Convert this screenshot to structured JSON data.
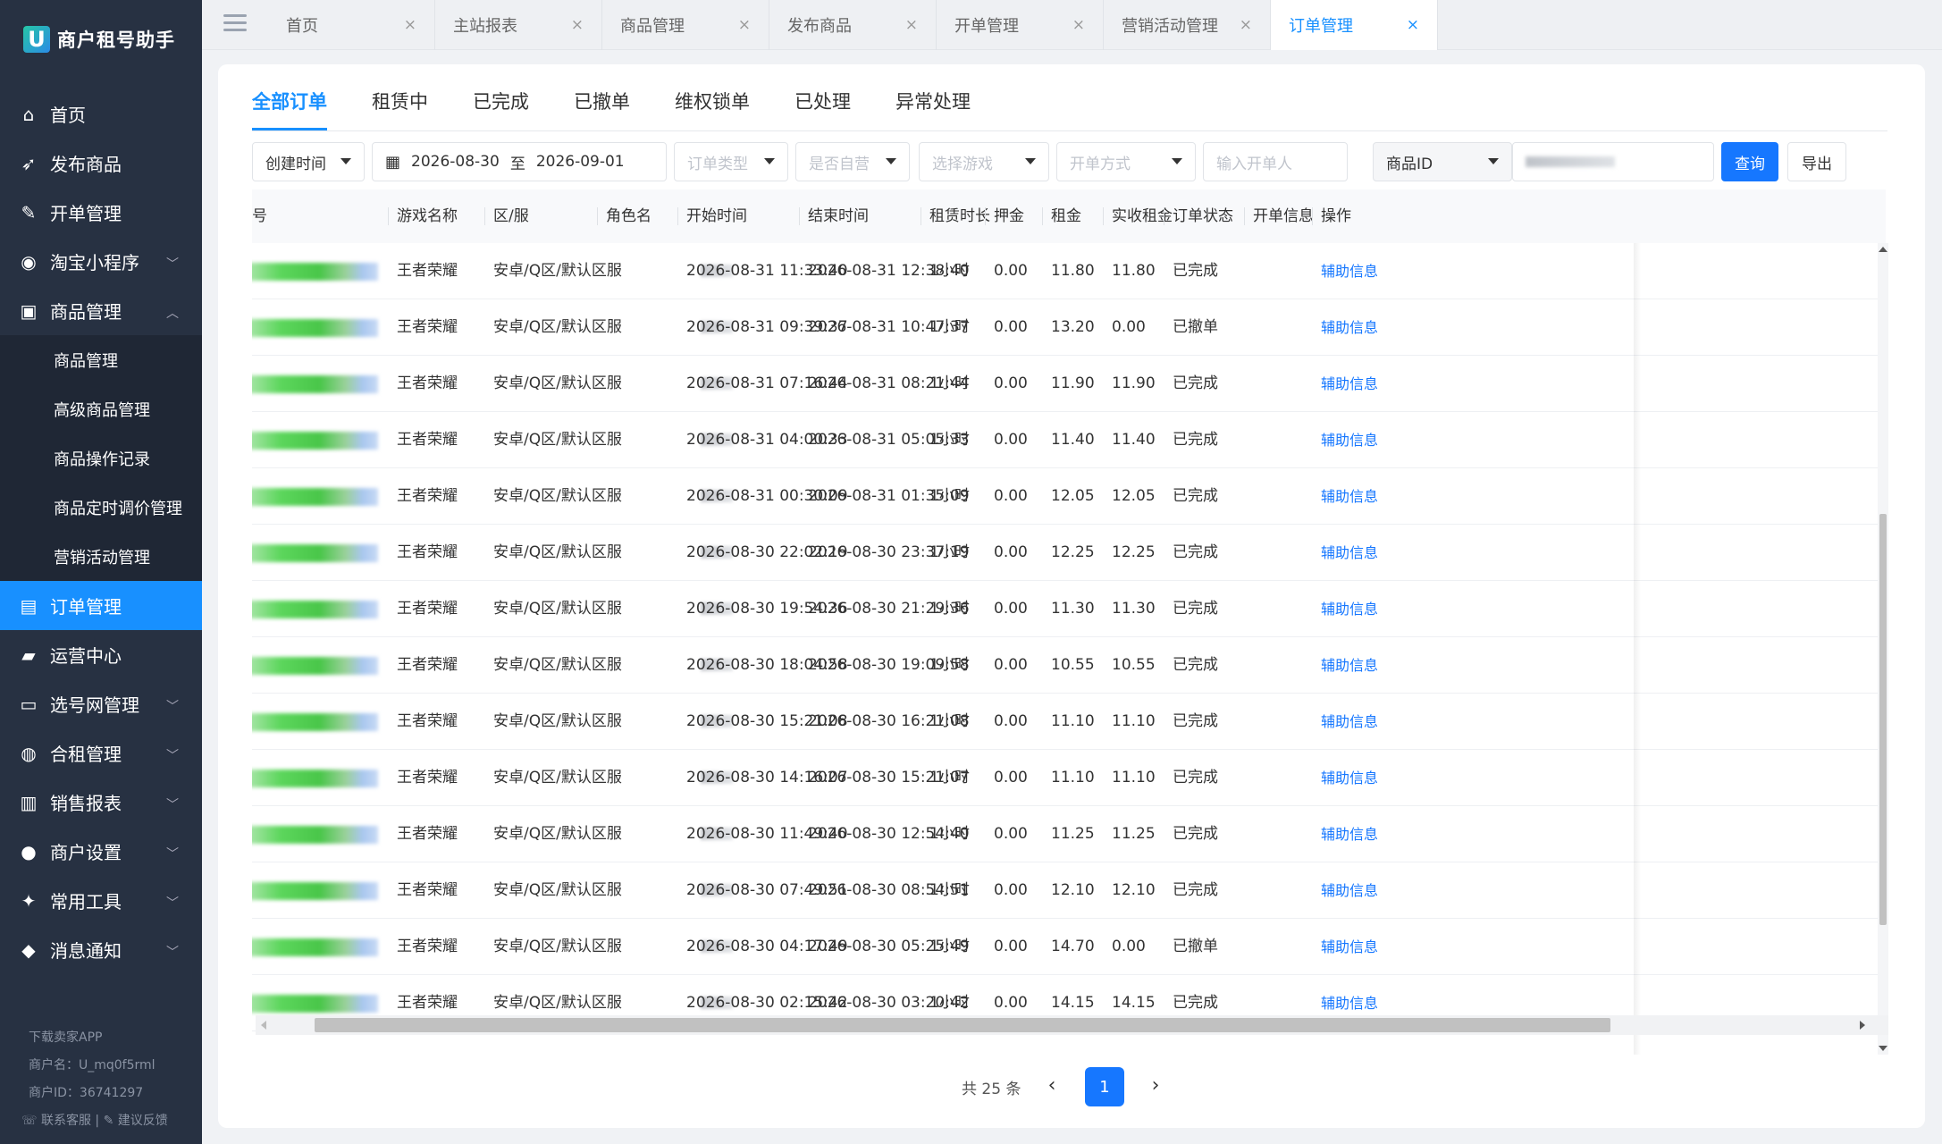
{
  "app": {
    "logo_glyph": "U",
    "title": "商户租号助手"
  },
  "sidebar": {
    "items": [
      {
        "label": "首页",
        "icon": "home-icon"
      },
      {
        "label": "发布商品",
        "icon": "rocket-icon"
      },
      {
        "label": "开单管理",
        "icon": "pencil-icon"
      },
      {
        "label": "淘宝小程序",
        "icon": "taobao-icon",
        "expandable": true
      },
      {
        "label": "商品管理",
        "icon": "cube-icon",
        "expanded": true
      }
    ],
    "sub_items": [
      "商品管理",
      "高级商品管理",
      "商品操作记录",
      "商品定时调价管理",
      "营销活动管理"
    ],
    "items_after": [
      {
        "label": "订单管理",
        "icon": "order-list-icon",
        "active": true
      },
      {
        "label": "运营中心",
        "icon": "chart-area-icon"
      },
      {
        "label": "选号网管理",
        "icon": "monitor-icon",
        "expandable": true
      },
      {
        "label": "合租管理",
        "icon": "users-icon",
        "expandable": true
      },
      {
        "label": "销售报表",
        "icon": "bar-chart-icon",
        "expandable": true
      },
      {
        "label": "商户设置",
        "icon": "settings-icon",
        "expandable": true
      },
      {
        "label": "常用工具",
        "icon": "wrench-icon",
        "expandable": true
      },
      {
        "label": "消息通知",
        "icon": "bell-icon",
        "expandable": true
      }
    ],
    "footer": {
      "download": "下载卖家APP",
      "merchant_name": "商户名：U_mq0f5rml",
      "merchant_id": "商户ID：36741297",
      "contact": "联系客服",
      "sep": "|",
      "feedback": "建议反馈"
    }
  },
  "tabs": [
    {
      "label": "首页",
      "active": false
    },
    {
      "label": "主站报表",
      "active": false
    },
    {
      "label": "商品管理",
      "active": false
    },
    {
      "label": "发布商品",
      "active": false
    },
    {
      "label": "开单管理",
      "active": false
    },
    {
      "label": "营销活动管理",
      "active": false
    },
    {
      "label": "订单管理",
      "active": true
    }
  ],
  "close_glyph": "×",
  "status_tabs": [
    "全部订单",
    "租赁中",
    "已完成",
    "已撤单",
    "维权锁单",
    "已处理",
    "异常处理"
  ],
  "filters": {
    "created_time": "创建时间",
    "date_from": "2026-08-30",
    "date_to_sep": "至",
    "date_to": "2026-09-01",
    "order_type": "订单类型",
    "self_operated": "是否自营",
    "game": "选择游戏",
    "open_method": "开单方式",
    "opener_placeholder": "输入开单人",
    "id_type": "商品ID",
    "query": "查询",
    "export": "导出"
  },
  "table": {
    "columns": [
      "号",
      "游戏名称",
      "区/服",
      "角色名",
      "开始时间",
      "结束时间",
      "租赁时长",
      "押金",
      "租金",
      "实收租金",
      "订单状态",
      "开单信息",
      "操作"
    ],
    "rows": [
      {
        "game": "王者荣耀",
        "server": "安卓/Q区/默认区服",
        "start": "2026-08-31 11:33:40",
        "end": "2026-08-31 12:38:40",
        "duration": "1小时",
        "deposit": "0.00",
        "rent": "11.80",
        "received": "11.80",
        "status": "已完成",
        "action": "辅助信息"
      },
      {
        "game": "王者荣耀",
        "server": "安卓/Q区/默认区服",
        "start": "2026-08-31 09:39:37",
        "end": "2026-08-31 10:47:37",
        "duration": "1小时",
        "deposit": "0.00",
        "rent": "13.20",
        "received": "0.00",
        "status": "已撤单",
        "action": "辅助信息"
      },
      {
        "game": "王者荣耀",
        "server": "安卓/Q区/默认区服",
        "start": "2026-08-31 07:16:44",
        "end": "2026-08-31 08:21:44",
        "duration": "1小时",
        "deposit": "0.00",
        "rent": "11.90",
        "received": "11.90",
        "status": "已完成",
        "action": "辅助信息"
      },
      {
        "game": "王者荣耀",
        "server": "安卓/Q区/默认区服",
        "start": "2026-08-31 04:00:33",
        "end": "2026-08-31 05:05:33",
        "duration": "1小时",
        "deposit": "0.00",
        "rent": "11.40",
        "received": "11.40",
        "status": "已完成",
        "action": "辅助信息"
      },
      {
        "game": "王者荣耀",
        "server": "安卓/Q区/默认区服",
        "start": "2026-08-31 00:30:09",
        "end": "2026-08-31 01:35:09",
        "duration": "1小时",
        "deposit": "0.00",
        "rent": "12.05",
        "received": "12.05",
        "status": "已完成",
        "action": "辅助信息"
      },
      {
        "game": "王者荣耀",
        "server": "安卓/Q区/默认区服",
        "start": "2026-08-30 22:02:19",
        "end": "2026-08-30 23:37:19",
        "duration": "1小时",
        "deposit": "0.00",
        "rent": "12.25",
        "received": "12.25",
        "status": "已完成",
        "action": "辅助信息"
      },
      {
        "game": "王者荣耀",
        "server": "安卓/Q区/默认区服",
        "start": "2026-08-30 19:54:36",
        "end": "2026-08-30 21:29:36",
        "duration": "1小时",
        "deposit": "0.00",
        "rent": "11.30",
        "received": "11.30",
        "status": "已完成",
        "action": "辅助信息"
      },
      {
        "game": "王者荣耀",
        "server": "安卓/Q区/默认区服",
        "start": "2026-08-30 18:04:58",
        "end": "2026-08-30 19:09:58",
        "duration": "1小时",
        "deposit": "0.00",
        "rent": "10.55",
        "received": "10.55",
        "status": "已完成",
        "action": "辅助信息"
      },
      {
        "game": "王者荣耀",
        "server": "安卓/Q区/默认区服",
        "start": "2026-08-30 15:21:08",
        "end": "2026-08-30 16:21:08",
        "duration": "1小时",
        "deposit": "0.00",
        "rent": "11.10",
        "received": "11.10",
        "status": "已完成",
        "action": "辅助信息"
      },
      {
        "game": "王者荣耀",
        "server": "安卓/Q区/默认区服",
        "start": "2026-08-30 14:16:07",
        "end": "2026-08-30 15:21:07",
        "duration": "1小时",
        "deposit": "0.00",
        "rent": "11.10",
        "received": "11.10",
        "status": "已完成",
        "action": "辅助信息"
      },
      {
        "game": "王者荣耀",
        "server": "安卓/Q区/默认区服",
        "start": "2026-08-30 11:49:40",
        "end": "2026-08-30 12:54:40",
        "duration": "1小时",
        "deposit": "0.00",
        "rent": "11.25",
        "received": "11.25",
        "status": "已完成",
        "action": "辅助信息"
      },
      {
        "game": "王者荣耀",
        "server": "安卓/Q区/默认区服",
        "start": "2026-08-30 07:49:51",
        "end": "2026-08-30 08:54:51",
        "duration": "1小时",
        "deposit": "0.00",
        "rent": "12.10",
        "received": "12.10",
        "status": "已完成",
        "action": "辅助信息"
      },
      {
        "game": "王者荣耀",
        "server": "安卓/Q区/默认区服",
        "start": "2026-08-30 04:17:49",
        "end": "2026-08-30 05:25:49",
        "duration": "1小时",
        "deposit": "0.00",
        "rent": "14.70",
        "received": "0.00",
        "status": "已撤单",
        "action": "辅助信息"
      },
      {
        "game": "王者荣耀",
        "server": "安卓/Q区/默认区服",
        "start": "2026-08-30 02:15:42",
        "end": "2026-08-30 03:20:42",
        "duration": "1小时",
        "deposit": "0.00",
        "rent": "14.15",
        "received": "14.15",
        "status": "已完成",
        "action": "辅助信息"
      }
    ]
  },
  "pagination": {
    "total": "共 25 条",
    "current": "1",
    "prev": "‹",
    "next": "›"
  },
  "colors": {
    "sidebar_bg": "#273142",
    "accent": "#1677ff",
    "active_menu": "#1890ff"
  }
}
